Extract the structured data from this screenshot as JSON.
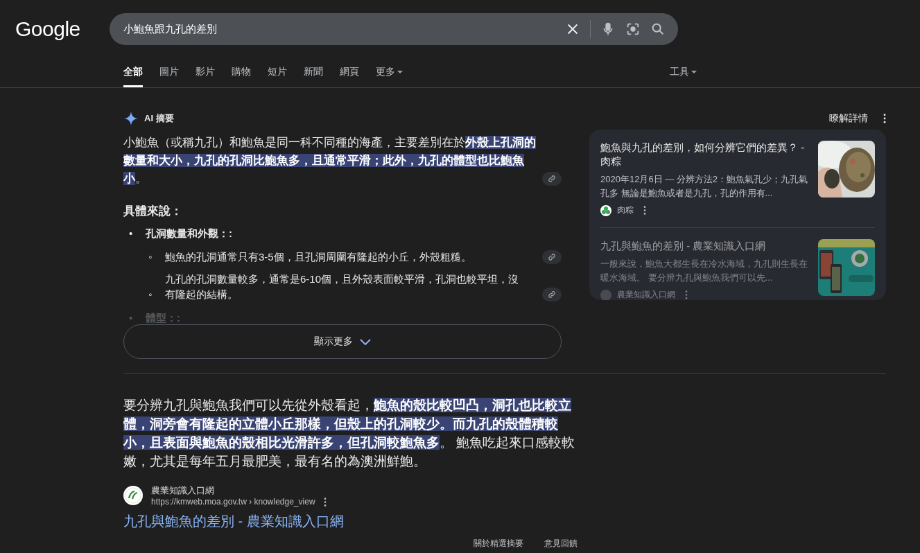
{
  "header": {
    "logo": "Google",
    "search": {
      "value": "小鮑魚跟九孔的差別"
    }
  },
  "tabs": [
    {
      "label": "全部",
      "selected": true,
      "has_menu": false
    },
    {
      "label": "圖片",
      "selected": false,
      "has_menu": false
    },
    {
      "label": "影片",
      "selected": false,
      "has_menu": false
    },
    {
      "label": "購物",
      "selected": false,
      "has_menu": false
    },
    {
      "label": "短片",
      "selected": false,
      "has_menu": false
    },
    {
      "label": "新聞",
      "selected": false,
      "has_menu": false
    },
    {
      "label": "網頁",
      "selected": false,
      "has_menu": false
    },
    {
      "label": "更多",
      "selected": false,
      "has_menu": true
    }
  ],
  "tools": {
    "label": "工具",
    "has_menu": true
  },
  "ai_overview": {
    "label": "AI 摘要",
    "learn_more": "瞭解詳情",
    "summary": [
      {
        "text": "小鮑魚（或稱九孔）和鮑魚是同一科不同種的海產，主要差別在於",
        "highlighted": false
      },
      {
        "text": "外殼上孔洞的數量和大小，九孔的孔洞比鮑魚多，且通常平滑；此外，九孔的體型也比鮑魚小",
        "highlighted": true
      },
      {
        "text": "。",
        "highlighted": false
      }
    ],
    "subheading": "具體來說：",
    "points": [
      {
        "marker": "•",
        "title": "孔洞數量和外觀：:",
        "faded": false,
        "children": [
          {
            "marker": "◦",
            "text": "鮑魚的孔洞通常只有3-5個，且孔洞周圍有隆起的小丘，外殼粗糙。"
          },
          {
            "marker": "◦",
            "text": "九孔的孔洞數量較多，通常是6-10個，且外殼表面較平滑，孔洞也較平坦，沒有隆起的結構。"
          }
        ]
      },
      {
        "marker": "•",
        "title": "體型：:",
        "faded": true
      }
    ],
    "show_more": "顯示更多",
    "sources": [
      {
        "title": "鮑魚與九孔的差別，如何分辨它們的差異？ - 肉粽",
        "snippet": "2020年12月6日 — 分辨方法2：鮑魚氣孔少；九孔氣孔多 無論是鮑魚或者是九孔，孔的作用有...",
        "site": "肉粽",
        "faded": false
      },
      {
        "title": "九孔與鮑魚的差別 - 農業知識入口網",
        "snippet": "一般來說，鮑魚大都生長在冷水海域，九孔則生長在暖水海域。 要分辨九孔與鮑魚我們可以先...",
        "site": "農業知識入口網",
        "faded": true,
        "kind": "banner"
      }
    ]
  },
  "snippet": {
    "body": [
      {
        "text": "要分辨九孔與鮑魚我們可以先從外殼看起，",
        "highlighted": false
      },
      {
        "text": "鮑魚的殼比較凹凸，洞孔也比較立體，洞旁會有隆起的立體小丘那樣，但殼上的孔洞較少。",
        "highlighted": true
      },
      {
        "text": "而九孔的殼體積較小，且表面與鮑魚的殼相比光滑許多，但孔洞較鮑魚多",
        "highlighted": true
      },
      {
        "text": "。 鮑魚吃起來口感較軟嫩，尤其是每年五月最肥美，最有名的為澳洲鮮鮑。",
        "highlighted": false
      }
    ],
    "site": "農業知識入口網",
    "url": "https://kmweb.moa.gov.tw › knowledge_view",
    "link": "九孔與鮑魚的差別 - 農業知識入口網"
  },
  "footer": [
    "關於精選摘要",
    "意見回饋"
  ]
}
